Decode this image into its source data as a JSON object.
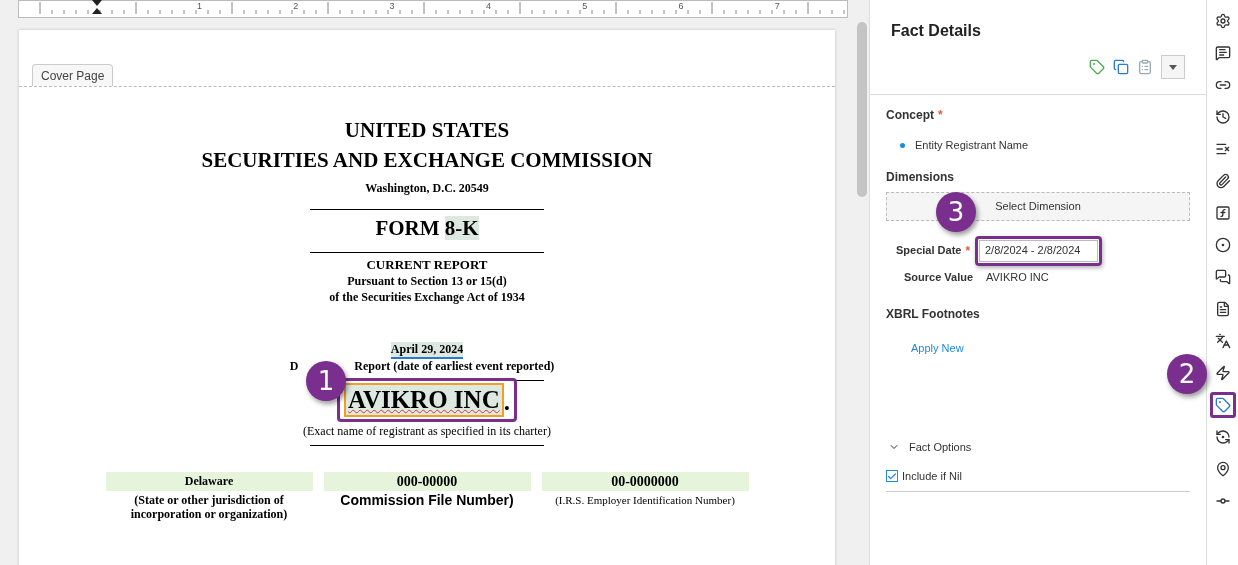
{
  "ruler": {
    "marks": [
      "1",
      "2",
      "3",
      "4",
      "5",
      "6",
      "7"
    ]
  },
  "document": {
    "section_tab": "Cover Page",
    "title_lines": [
      "UNITED STATES",
      "SECURITIES AND EXCHANGE COMMISSION"
    ],
    "address": "Washington, D.C. 20549",
    "form": [
      {
        "text": "FORM ",
        "tagged": false
      },
      {
        "text": "8-K",
        "tagged": true
      }
    ],
    "report_lines": [
      "CURRENT REPORT",
      "Pursuant to Section 13 or 15(d)",
      "of the Securities Exchange Act of 1934"
    ],
    "report_date": {
      "text": "April 29, 2024",
      "tagged": true
    },
    "report_date_caption": [
      "D",
      "Report (date of earliest event reported)"
    ],
    "registrant": {
      "text": "AVIKRO INC",
      "suffix": ".",
      "selected": true
    },
    "registrant_caption": "(Exact name of registrant as specified in its charter)",
    "id_fields": [
      {
        "value": "Delaware",
        "caption": "(State or other jurisdiction of incorporation or organization)",
        "kind": "bold"
      },
      {
        "value": "000-00000",
        "caption": "Commission File Number)",
        "kind": "sans"
      },
      {
        "value": "00-0000000",
        "caption": "(I.R.S. Employer Identification Number)",
        "kind": "plain"
      }
    ]
  },
  "fact_details": {
    "title": "Fact Details",
    "concept": {
      "label": "Concept",
      "required": true,
      "required_mark": "*",
      "value": "Entity Registrant Name"
    },
    "dimensions": {
      "label": "Dimensions",
      "button": "Select Dimension"
    },
    "special_date": {
      "label": "Special Date",
      "required": true,
      "required_mark": "*",
      "value": "2/8/2024 - 2/8/2024"
    },
    "source_value": {
      "label": "Source Value",
      "value": "AVIKRO INC"
    },
    "footnotes": {
      "label": "XBRL Footnotes",
      "link": "Apply New"
    },
    "fact_options": {
      "label": "Fact Options",
      "expanded": true,
      "include_if_nil": {
        "label": "Include if Nil",
        "checked": true
      }
    }
  },
  "rail": [
    {
      "selected": false
    },
    {
      "selected": false
    },
    {
      "selected": false
    },
    {
      "selected": false
    },
    {
      "selected": false
    },
    {
      "selected": false
    },
    {
      "selected": false
    },
    {
      "selected": false
    },
    {
      "selected": false
    },
    {
      "selected": false
    },
    {
      "selected": false
    },
    {
      "selected": false
    },
    {
      "selected": true
    },
    {
      "selected": false
    },
    {
      "selected": false
    },
    {
      "selected": false
    }
  ],
  "callouts": [
    "1",
    "2",
    "3"
  ]
}
